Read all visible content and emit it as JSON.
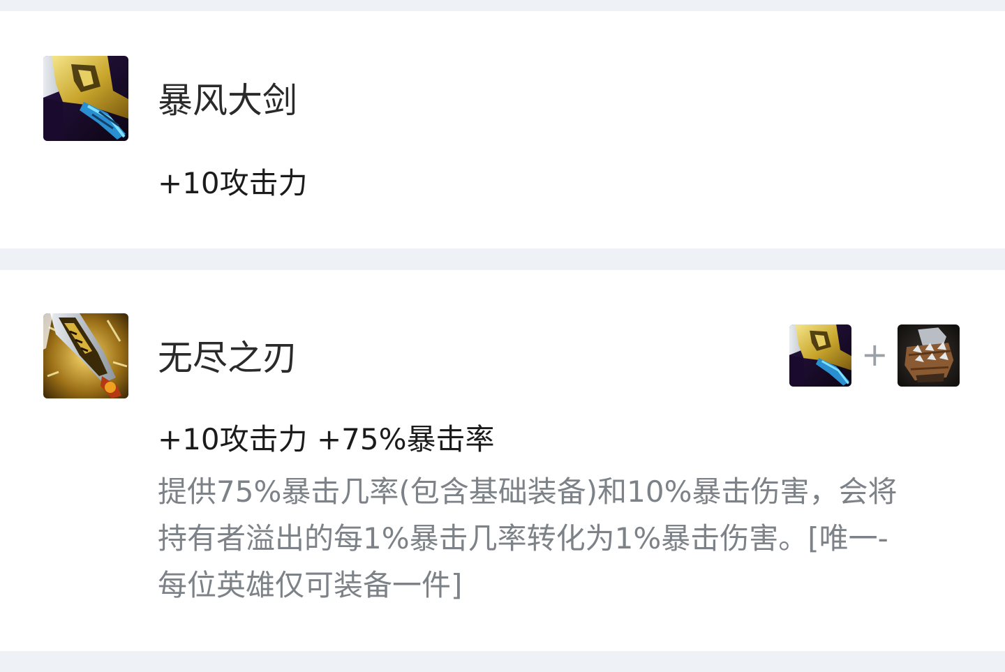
{
  "items": [
    {
      "name": "暴风大剑",
      "stats": "+10攻击力",
      "icon": "bf-sword-icon"
    },
    {
      "name": "无尽之刃",
      "stats": "+10攻击力 +75%暴击率",
      "icon": "infinity-edge-icon",
      "description_lines": [
        "提供75%暴击几率(包含基础装备)和10%暴击伤害，会将",
        "持有者溢出的每1%暴击几率转化为1%暴击伤害。[唯一-",
        "每位英雄仅可装备一件]"
      ],
      "recipe": {
        "components": [
          "bf-sword-icon",
          "sparring-gloves-icon"
        ],
        "plus": "+"
      }
    }
  ],
  "colors": {
    "page_background": "#eef1f6",
    "card_background": "#ffffff",
    "name_text": "#2a2a2a",
    "stats_text": "#1b1b1b",
    "description_text": "#7c8287",
    "plus_sign": "#9aa0a6"
  }
}
